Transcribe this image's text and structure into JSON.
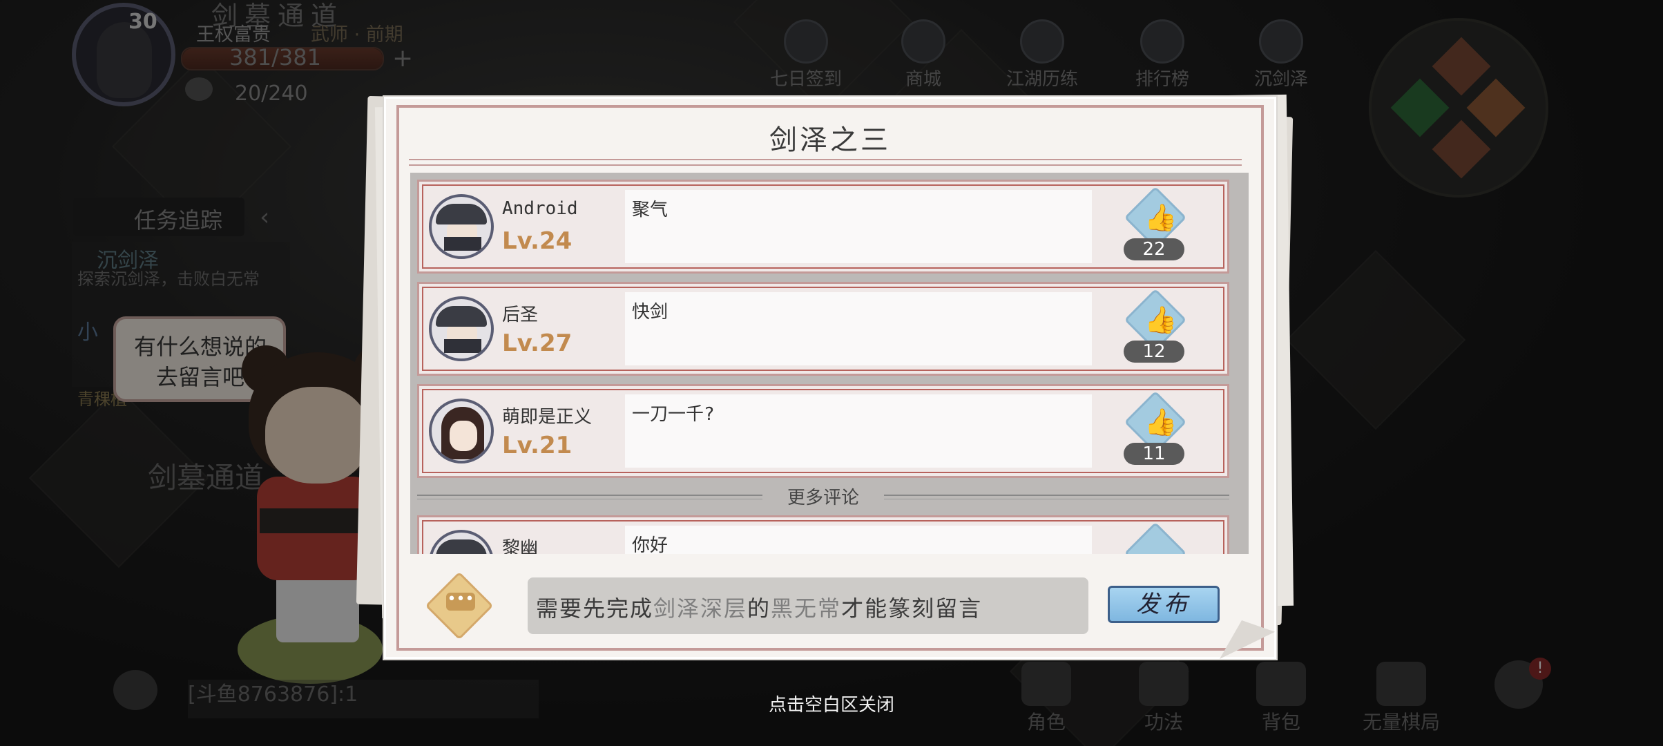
{
  "player": {
    "level": "30",
    "name": "王权富贵",
    "rank": "武师 · 前期",
    "hp": "381/381",
    "hp_percent": 100,
    "stamina": "20/240",
    "plus": "+"
  },
  "area": {
    "title": "剑墓通道",
    "label": "剑墓通道"
  },
  "quest": {
    "tab_label": "任务追踪",
    "collapse": "‹",
    "name": "沉剑泽",
    "desc": "探索沉剑泽，击败白无常",
    "name2": "小",
    "extra": "青稞植"
  },
  "top_nav": [
    {
      "label": "七日签到",
      "icon": "calendar-seven-icon"
    },
    {
      "label": "商城",
      "icon": "shop-icon"
    },
    {
      "label": "江湖历练",
      "icon": "sword-icon"
    },
    {
      "label": "排行榜",
      "icon": "ranking-icon"
    },
    {
      "label": "沉剑泽",
      "icon": "scroll-icon"
    }
  ],
  "mascot": {
    "bubble": "有什么想说的\n去留言吧"
  },
  "modal": {
    "title": "剑泽之三",
    "comments": [
      {
        "name": "Android",
        "level": "Lv.24",
        "text": "聚气",
        "likes": "22"
      },
      {
        "name": "后圣",
        "level": "Lv.27",
        "text": "快剑",
        "likes": "12"
      },
      {
        "name": "萌即是正义",
        "level": "Lv.21",
        "text": "一刀一千?",
        "likes": "11"
      },
      {
        "name": "黎幽",
        "level": "",
        "text": "你好",
        "likes": ""
      }
    ],
    "more_label": "更多评论",
    "input_prefix": "需要先完成",
    "input_hl1": "剑泽深层",
    "input_mid": "的",
    "input_hl2": "黑无常",
    "input_suffix": "才能篆刻留言",
    "publish_label": "发布"
  },
  "chat": {
    "text": "[斗鱼8763876]:1"
  },
  "bottom_nav": [
    {
      "label": "角色",
      "icon": "character-icon"
    },
    {
      "label": "功法",
      "icon": "skill-book-icon"
    },
    {
      "label": "背包",
      "icon": "bag-icon"
    },
    {
      "label": "无量棋局",
      "icon": "chessboard-icon"
    }
  ],
  "notification_badge": "!",
  "close_hint": "点击空白区关闭"
}
